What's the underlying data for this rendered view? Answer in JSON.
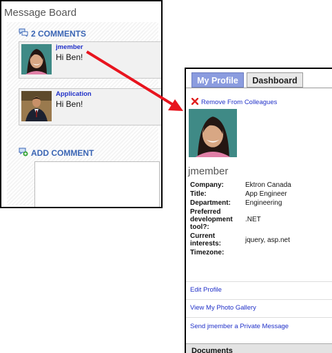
{
  "message_board": {
    "title": "Message Board",
    "comments_header": "2 COMMENTS",
    "comments": [
      {
        "author": "jmember",
        "text": "Hi Ben!"
      },
      {
        "author": "Application",
        "text": "Hi Ben!"
      }
    ],
    "add_comment_label": "ADD COMMENT"
  },
  "profile": {
    "tabs": [
      {
        "label": "My Profile",
        "active": true
      },
      {
        "label": "Dashboard",
        "active": false
      }
    ],
    "remove_label": "Remove From Colleagues",
    "username": "jmember",
    "fields": [
      {
        "label": "Company:",
        "value": "Ektron Canada"
      },
      {
        "label": "Title:",
        "value": "App Engineer"
      },
      {
        "label": "Department:",
        "value": "Engineering"
      },
      {
        "label": "Preferred development tool?:",
        "value": ".NET"
      },
      {
        "label": "Current interests:",
        "value": "jquery, asp.net"
      },
      {
        "label": "Timezone:",
        "value": ""
      }
    ],
    "links": [
      "Edit Profile",
      "View My Photo Gallery",
      "Send jmember a Private Message"
    ],
    "documents_label": "Documents"
  },
  "colors": {
    "link_blue": "#2030c8",
    "header_blue": "#3a65b4",
    "active_tab": "#8b9cdf",
    "arrow_red": "#e8141e"
  },
  "icons": [
    "comments-icon",
    "add-comment-icon",
    "remove-icon"
  ]
}
